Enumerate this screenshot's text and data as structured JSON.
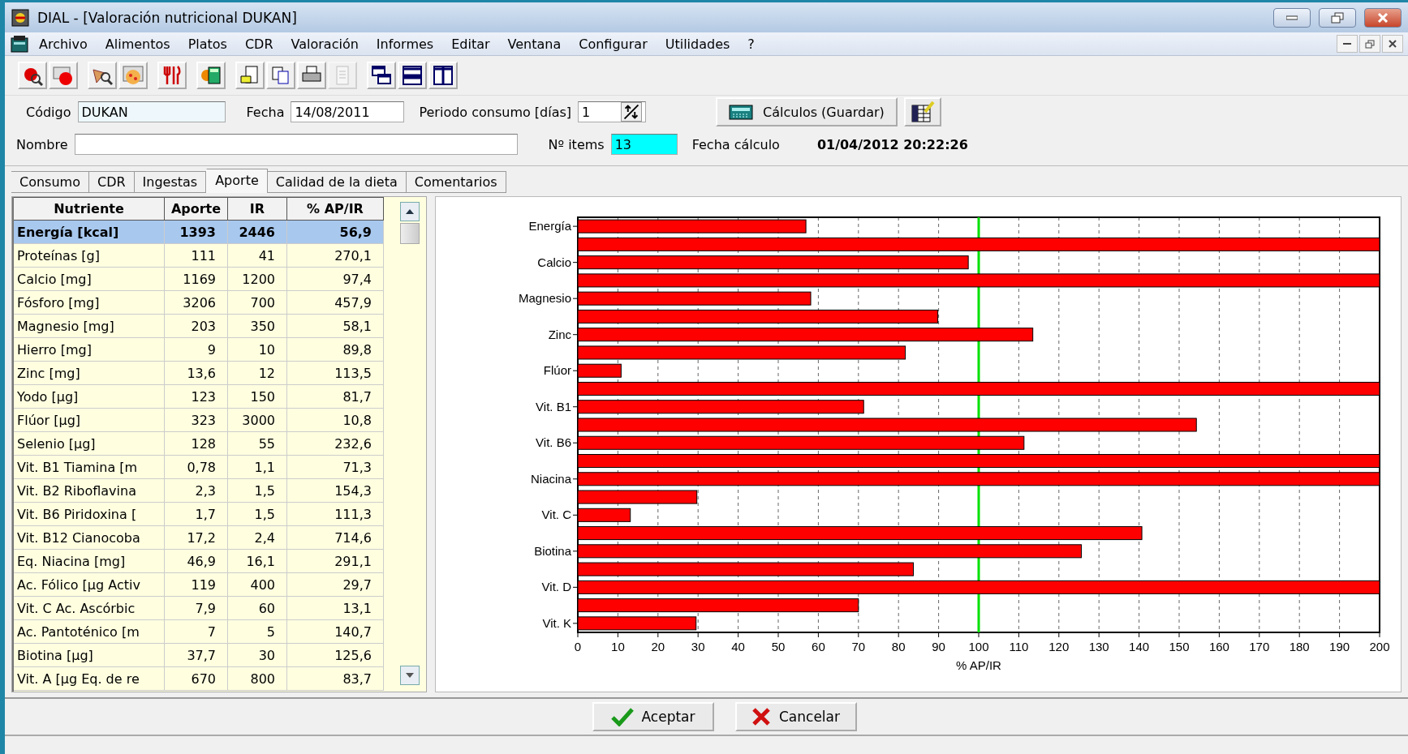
{
  "window": {
    "title": "DIAL - [Valoración nutricional DUKAN]"
  },
  "menu": [
    "Archivo",
    "Alimentos",
    "Platos",
    "CDR",
    "Valoración",
    "Informes",
    "Editar",
    "Ventana",
    "Configurar",
    "Utilidades",
    "?"
  ],
  "toolbar": [
    [
      {
        "kind": "apple-search",
        "disabled": false
      },
      {
        "kind": "apple-card",
        "disabled": false
      }
    ],
    [
      {
        "kind": "food-search",
        "disabled": false
      },
      {
        "kind": "pizza-card",
        "disabled": false
      }
    ],
    [
      {
        "kind": "cutlery",
        "disabled": false
      }
    ],
    [
      {
        "kind": "calculator",
        "disabled": false
      }
    ],
    [
      {
        "kind": "document-edit",
        "disabled": false
      },
      {
        "kind": "copy",
        "disabled": false
      },
      {
        "kind": "print",
        "disabled": false
      },
      {
        "kind": "page",
        "disabled": true
      }
    ],
    [
      {
        "kind": "cascade",
        "disabled": false
      },
      {
        "kind": "tile-horizontal",
        "disabled": false
      },
      {
        "kind": "tile-vertical",
        "disabled": false
      }
    ]
  ],
  "form": {
    "codigo": {
      "label": "Código",
      "value": "DUKAN"
    },
    "fecha": {
      "label": "Fecha",
      "value": "14/08/2011"
    },
    "periodo": {
      "label": "Periodo consumo [días]",
      "value": "1"
    },
    "calc_button": "Cálculos (Guardar)",
    "nombre": {
      "label": "Nombre"
    },
    "items": {
      "label": "Nº items",
      "value": "13"
    },
    "fecha_calculo": {
      "label": "Fecha cálculo",
      "value": "01/04/2012 20:22:26"
    }
  },
  "tabs": [
    {
      "label": "Consumo",
      "selected": false
    },
    {
      "label": "CDR",
      "selected": false
    },
    {
      "label": "Ingestas",
      "selected": false
    },
    {
      "label": "Aporte",
      "selected": true
    },
    {
      "label": "Calidad de la dieta",
      "selected": false
    },
    {
      "label": "Comentarios",
      "selected": false
    }
  ],
  "table": {
    "columns": [
      "Nutriente",
      "Aporte",
      "IR",
      "% AP/IR"
    ],
    "rows": [
      {
        "cells": [
          "Energía [kcal]",
          "1393",
          "2446",
          "56,9"
        ],
        "selected": true
      },
      {
        "cells": [
          "Proteínas [g]",
          "111",
          "41",
          "270,1"
        ],
        "selected": false
      },
      {
        "cells": [
          "Calcio [mg]",
          "1169",
          "1200",
          "97,4"
        ],
        "selected": false
      },
      {
        "cells": [
          "Fósforo [mg]",
          "3206",
          "700",
          "457,9"
        ],
        "selected": false
      },
      {
        "cells": [
          "Magnesio [mg]",
          "203",
          "350",
          "58,1"
        ],
        "selected": false
      },
      {
        "cells": [
          "Hierro [mg]",
          "9",
          "10",
          "89,8"
        ],
        "selected": false
      },
      {
        "cells": [
          "Zinc [mg]",
          "13,6",
          "12",
          "113,5"
        ],
        "selected": false
      },
      {
        "cells": [
          "Yodo [µg]",
          "123",
          "150",
          "81,7"
        ],
        "selected": false
      },
      {
        "cells": [
          "Flúor [µg]",
          "323",
          "3000",
          "10,8"
        ],
        "selected": false
      },
      {
        "cells": [
          "Selenio [µg]",
          "128",
          "55",
          "232,6"
        ],
        "selected": false
      },
      {
        "cells": [
          "Vit. B1 Tiamina [m",
          "0,78",
          "1,1",
          "71,3"
        ],
        "selected": false
      },
      {
        "cells": [
          "Vit. B2 Riboflavina",
          "2,3",
          "1,5",
          "154,3"
        ],
        "selected": false
      },
      {
        "cells": [
          "Vit. B6 Piridoxina [",
          "1,7",
          "1,5",
          "111,3"
        ],
        "selected": false
      },
      {
        "cells": [
          "Vit. B12 Cianocoba",
          "17,2",
          "2,4",
          "714,6"
        ],
        "selected": false
      },
      {
        "cells": [
          "Eq. Niacina [mg]",
          "46,9",
          "16,1",
          "291,1"
        ],
        "selected": false
      },
      {
        "cells": [
          "Ac. Fólico [µg Activ",
          "119",
          "400",
          "29,7"
        ],
        "selected": false
      },
      {
        "cells": [
          "Vit. C Ac. Ascórbic",
          "7,9",
          "60",
          "13,1"
        ],
        "selected": false
      },
      {
        "cells": [
          "Ac. Pantoténico [m",
          "7",
          "5",
          "140,7"
        ],
        "selected": false
      },
      {
        "cells": [
          "Biotina [µg]",
          "37,7",
          "30",
          "125,6"
        ],
        "selected": false
      },
      {
        "cells": [
          "Vit. A [µg Eq. de re",
          "670",
          "800",
          "83,7"
        ],
        "selected": false
      }
    ]
  },
  "chart_data": {
    "type": "bar",
    "orientation": "horizontal",
    "xlabel": "% AP/IR",
    "categories": [
      "Energía",
      null,
      "Calcio",
      null,
      "Magnesio",
      null,
      "Zinc",
      null,
      "Flúor",
      null,
      "Vit. B1",
      null,
      "Vit. B6",
      null,
      "Niacina",
      null,
      "Vit. C",
      null,
      "Biotina",
      null,
      "Vit. D",
      null,
      "Vit. K"
    ],
    "series": [
      {
        "color": "#ff0000",
        "values": [
          56.9,
          200,
          97.4,
          200,
          58.1,
          89.8,
          113.5,
          81.7,
          10.8,
          200,
          71.3,
          154.3,
          111.3,
          200,
          200,
          29.7,
          13.1,
          140.7,
          125.6,
          83.7,
          200,
          70,
          29.5
        ]
      }
    ],
    "xlim": [
      0,
      200
    ],
    "xticks": [
      0,
      10,
      20,
      30,
      40,
      50,
      60,
      70,
      80,
      90,
      100,
      110,
      120,
      130,
      140,
      150,
      160,
      170,
      180,
      190,
      200
    ],
    "grid": true,
    "ref_lines": [
      {
        "axis": "x",
        "value": 100,
        "color": "#00e000"
      }
    ]
  },
  "buttons": [
    {
      "kind": "accept",
      "label": "Aceptar"
    },
    {
      "kind": "cancel",
      "label": "Cancelar"
    }
  ]
}
